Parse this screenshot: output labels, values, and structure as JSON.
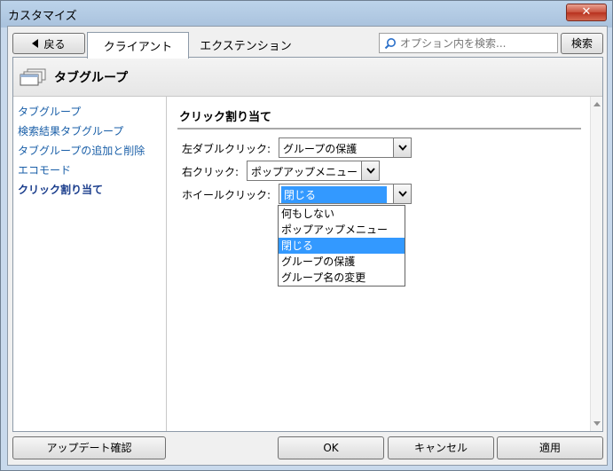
{
  "window": {
    "title": "カスタマイズ",
    "close_label": "✕"
  },
  "topbar": {
    "back_label": "戻る",
    "tabs": [
      {
        "label": "クライアント",
        "active": true
      },
      {
        "label": "エクステンション",
        "active": false
      }
    ],
    "search_placeholder": "オプション内を検索...",
    "search_button": "検索"
  },
  "header": {
    "title": "タブグループ",
    "icon": "tab-stack-icon"
  },
  "sidebar": {
    "items": [
      {
        "label": "タブグループ",
        "active": false
      },
      {
        "label": "検索結果タブグループ",
        "active": false
      },
      {
        "label": "タブグループの追加と削除",
        "active": false
      },
      {
        "label": "エコモード",
        "active": false
      },
      {
        "label": "クリック割り当て",
        "active": true
      }
    ]
  },
  "main": {
    "section_title": "クリック割り当て",
    "rows": [
      {
        "label": "左ダブルクリック:",
        "value": "グループの保護"
      },
      {
        "label": "右クリック:",
        "value": "ポップアップメニュー"
      },
      {
        "label": "ホイールクリック:",
        "value": "閉じる"
      }
    ],
    "dropdown_options": [
      "何もしない",
      "ポップアップメニュー",
      "閉じる",
      "グループの保護",
      "グループ名の変更"
    ],
    "dropdown_selected": "閉じる"
  },
  "footer": {
    "update_check": "アップデート確認",
    "ok": "OK",
    "cancel": "キャンセル",
    "apply": "適用"
  },
  "colors": {
    "link": "#1a5fa8",
    "selection": "#3399ff",
    "close_button": "#c8503b"
  }
}
